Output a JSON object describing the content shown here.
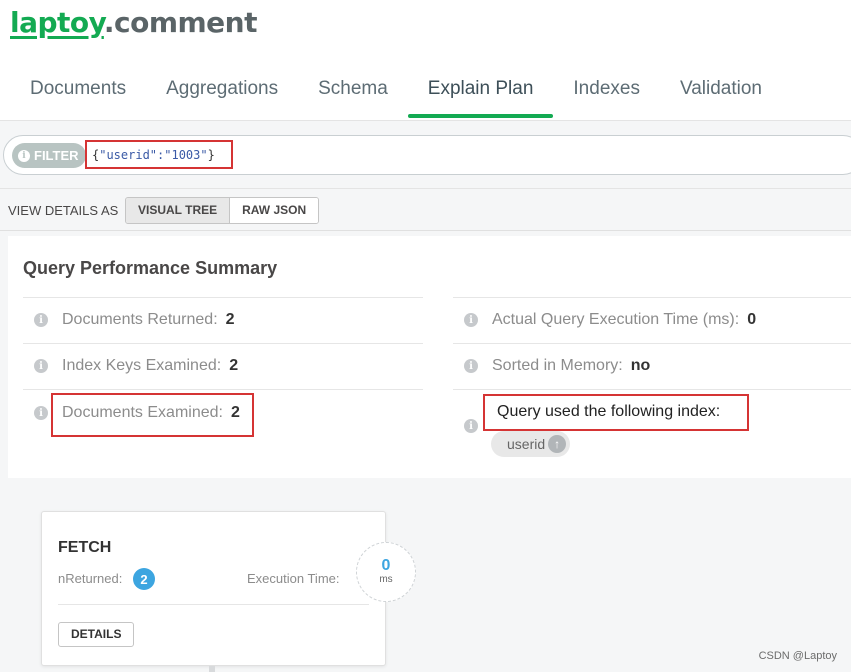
{
  "header": {
    "db_name": "laptoy",
    "coll_name": ".comment"
  },
  "tabs": [
    {
      "label": "Documents",
      "active": false
    },
    {
      "label": "Aggregations",
      "active": false
    },
    {
      "label": "Schema",
      "active": false
    },
    {
      "label": "Explain Plan",
      "active": true
    },
    {
      "label": "Indexes",
      "active": false
    },
    {
      "label": "Validation",
      "active": false
    }
  ],
  "filter": {
    "label": "FILTER",
    "query_open": "{",
    "query_body": "\"userid\":\"1003\"",
    "query_close": "}"
  },
  "view_details": {
    "label": "VIEW DETAILS AS",
    "options": [
      "VISUAL TREE",
      "RAW JSON"
    ],
    "selected": "VISUAL TREE"
  },
  "summary": {
    "title": "Query Performance Summary",
    "docs_returned_label": "Documents Returned:",
    "docs_returned_value": "2",
    "keys_examined_label": "Index Keys Examined:",
    "keys_examined_value": "2",
    "docs_examined_label": "Documents Examined:",
    "docs_examined_value": "2",
    "exec_time_label": "Actual Query Execution Time (ms):",
    "exec_time_value": "0",
    "sorted_label": "Sorted in Memory:",
    "sorted_value": "no",
    "index_label": "Query used the following index:",
    "index_name": "userid"
  },
  "stage": {
    "name": "FETCH",
    "nreturned_label": "nReturned:",
    "nreturned_value": "2",
    "exec_label": "Execution Time:",
    "exec_value": "0",
    "exec_unit": "ms",
    "details_label": "DETAILS"
  },
  "watermark": "CSDN @Laptoy",
  "colors": {
    "accent_green": "#13aa52",
    "highlight_red": "#d53434",
    "badge_blue": "#3ca5e0"
  }
}
